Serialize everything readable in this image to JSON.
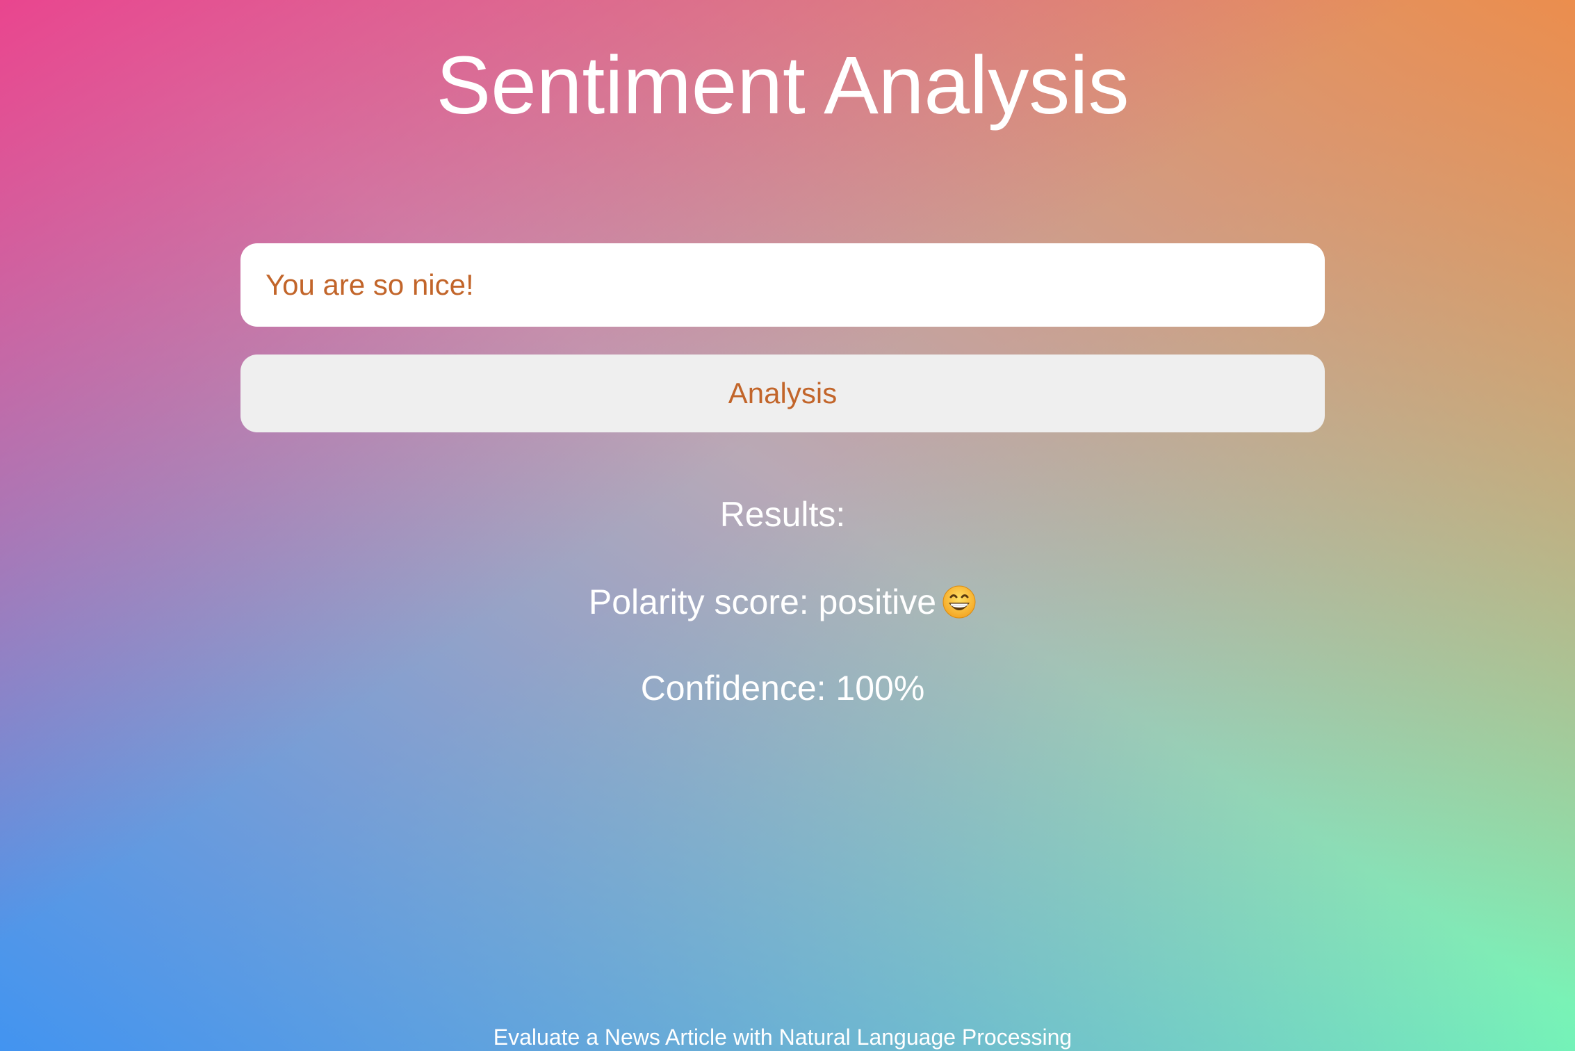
{
  "page": {
    "title": "Sentiment Analysis",
    "background_colors": [
      "#ec408c",
      "#ee8c48",
      "#4294f0",
      "#76f6b6"
    ]
  },
  "form": {
    "input_value": "You are so nice!",
    "button_label": "Analysis",
    "accent_color": "#c2652a"
  },
  "results": {
    "heading": "Results:",
    "polarity_text": "Polarity score: positive",
    "polarity_icon": "grinning-face-emoji-icon",
    "confidence_text": "Confidence: 100%"
  },
  "footer": {
    "text": "Evaluate a News Article with Natural Language Processing"
  }
}
